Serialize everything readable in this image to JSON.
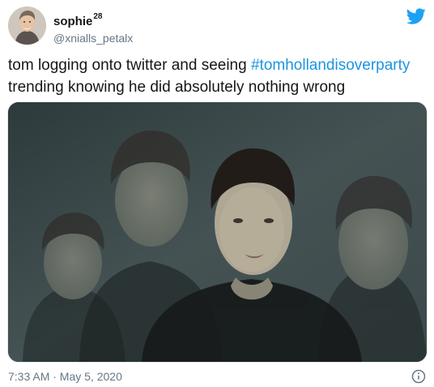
{
  "user": {
    "display_name": "sophie",
    "name_suffix": "28",
    "handle": "@xnialls_petalx"
  },
  "tweet": {
    "text_before_hashtag": "tom logging onto twitter and seeing ",
    "hashtag": "#tomhollandisoverparty",
    "text_after_hashtag": " trending knowing he did absolutely nothing wrong",
    "timestamp": "7:33 AM · May 5, 2020"
  },
  "icons": {
    "brand": "twitter-bird-icon",
    "info": "info-icon"
  },
  "colors": {
    "text": "#14171a",
    "secondary": "#657786",
    "link": "#1b95e0",
    "brand": "#1da1f2"
  }
}
